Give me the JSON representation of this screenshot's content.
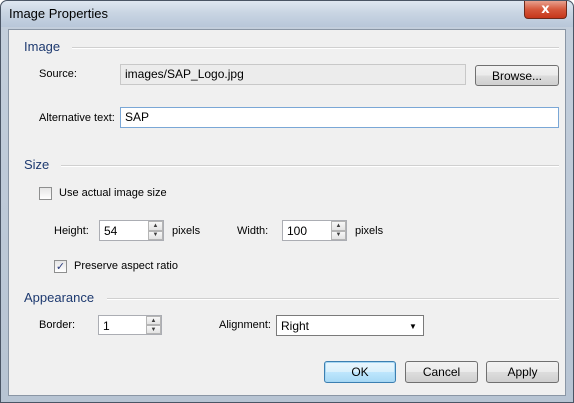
{
  "window": {
    "title": "Image Properties",
    "close_glyph": "x"
  },
  "image_section": {
    "heading": "Image",
    "source_label": "Source:",
    "source_value": "images/SAP_Logo.jpg",
    "browse_label": "Browse...",
    "alt_label": "Alternative text:",
    "alt_value": "SAP"
  },
  "size_section": {
    "heading": "Size",
    "use_actual_label": "Use actual image size",
    "use_actual_checked": false,
    "height_label": "Height:",
    "height_value": "54",
    "height_unit": "pixels",
    "width_label": "Width:",
    "width_value": "100",
    "width_unit": "pixels",
    "preserve_label": "Preserve aspect ratio",
    "preserve_checked": true
  },
  "appearance_section": {
    "heading": "Appearance",
    "border_label": "Border:",
    "border_value": "1",
    "alignment_label": "Alignment:",
    "alignment_value": "Right"
  },
  "buttons": {
    "ok": "OK",
    "cancel": "Cancel",
    "apply": "Apply"
  },
  "icons": {
    "spin_up": "▲",
    "spin_down": "▼",
    "dropdown": "▼",
    "check": "✓"
  }
}
